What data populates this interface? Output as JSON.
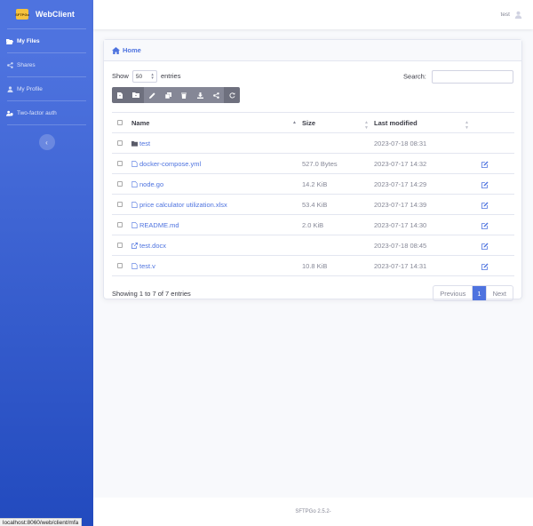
{
  "brand": {
    "logo_text": "SFTPGo",
    "title": "WebClient"
  },
  "sidebar": {
    "items": [
      {
        "label": "My Files",
        "icon": "folder-open-icon",
        "active": true
      },
      {
        "label": "Shares",
        "icon": "share-icon",
        "active": false
      },
      {
        "label": "My Profile",
        "icon": "user-icon",
        "active": false
      },
      {
        "label": "Two-factor auth",
        "icon": "user-shield-icon",
        "active": false
      }
    ],
    "toggle_glyph": "‹"
  },
  "topbar": {
    "username": "test"
  },
  "card": {
    "breadcrumb": "Home",
    "show_label": "Show",
    "entries_label": "entries",
    "page_size": "50",
    "search_label": "Search:",
    "search_value": ""
  },
  "toolbar": [
    "add-file-icon",
    "add-folder-icon",
    "rename-icon",
    "copy-icon",
    "delete-icon",
    "download-icon",
    "share-icon",
    "refresh-icon"
  ],
  "table": {
    "headers": {
      "name": "Name",
      "size": "Size",
      "modified": "Last modified"
    },
    "rows": [
      {
        "name": "test",
        "type": "folder",
        "size": "",
        "modified": "2023-07-18 08:31",
        "editable": false
      },
      {
        "name": "docker-compose.yml",
        "type": "file",
        "size": "527.0 Bytes",
        "modified": "2023-07-17 14:32",
        "editable": true
      },
      {
        "name": "node.go",
        "type": "file",
        "size": "14.2 KiB",
        "modified": "2023-07-17 14:29",
        "editable": true
      },
      {
        "name": "price calculator utilization.xlsx",
        "type": "file",
        "size": "53.4 KiB",
        "modified": "2023-07-17 14:39",
        "editable": true
      },
      {
        "name": "README.md",
        "type": "file",
        "size": "2.0 KiB",
        "modified": "2023-07-17 14:30",
        "editable": true
      },
      {
        "name": "test.docx",
        "type": "link",
        "size": "",
        "modified": "2023-07-18 08:45",
        "editable": true
      },
      {
        "name": "test.v",
        "type": "file",
        "size": "10.8 KiB",
        "modified": "2023-07-17 14:31",
        "editable": true
      }
    ]
  },
  "info_text": "Showing 1 to 7 of 7 entries",
  "pagination": {
    "previous": "Previous",
    "current": "1",
    "next": "Next"
  },
  "footer": "SFTPGo 2.5.2-",
  "statusbar": "localhost:8060/web/client/mfa",
  "colors": {
    "primary": "#4e73df",
    "toolbar": "#858796"
  }
}
